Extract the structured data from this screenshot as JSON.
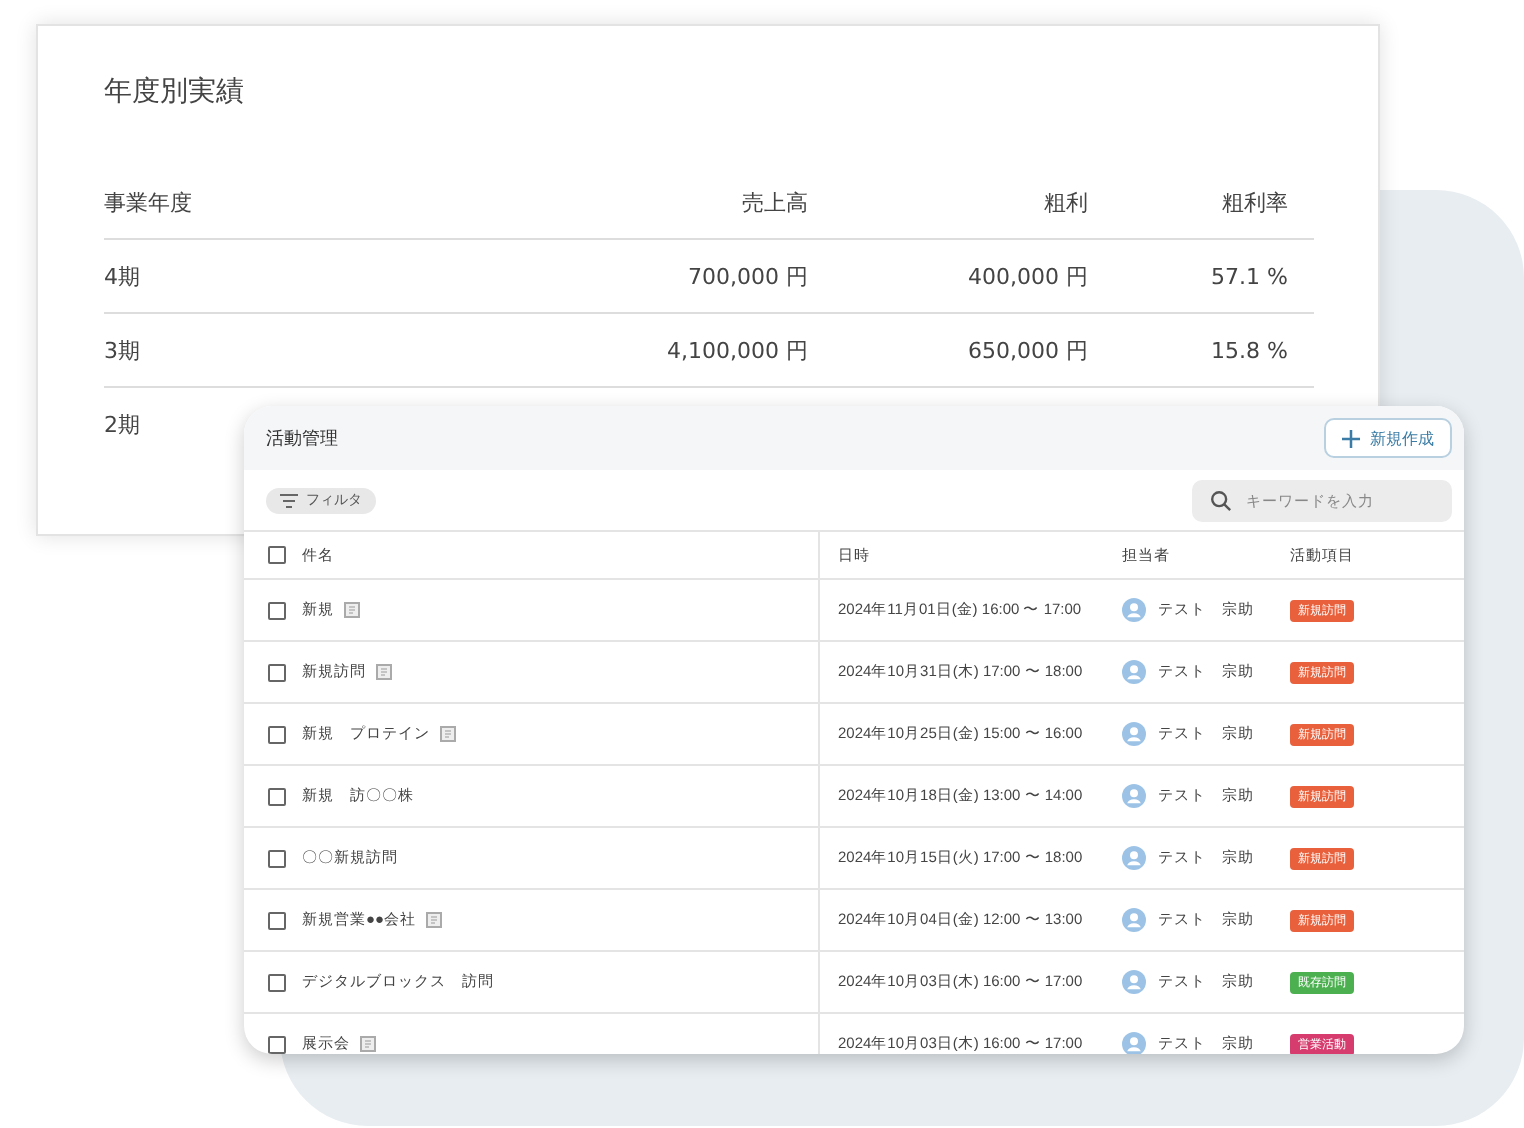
{
  "results_card": {
    "title": "年度別実績",
    "columns": [
      "事業年度",
      "売上高",
      "粗利",
      "粗利率"
    ],
    "rows": [
      [
        "4期",
        "700,000 円",
        "400,000 円",
        "57.1 %"
      ],
      [
        "3期",
        "4,100,000 円",
        "650,000 円",
        "15.8 %"
      ],
      [
        "2期"
      ]
    ]
  },
  "activity_card": {
    "title": "活動管理",
    "new_button": "新規作成",
    "filter": "フィルタ",
    "search": {
      "placeholder": "キーワードを入力"
    },
    "columns": [
      "件名",
      "日時",
      "担当者",
      "活動項目"
    ],
    "all_checked": false,
    "rows": [
      {
        "checked": false,
        "subject": "新規",
        "has_note": true,
        "datetime": "2024年11月01日(金) 16:00 〜 17:00",
        "owner": "テスト　宗助",
        "activity": "新規訪問",
        "color": "#e8603c"
      },
      {
        "checked": false,
        "subject": "新規訪問",
        "has_note": true,
        "datetime": "2024年10月31日(木) 17:00 〜 18:00",
        "owner": "テスト　宗助",
        "activity": "新規訪問",
        "color": "#e8603c"
      },
      {
        "checked": false,
        "subject": "新規　プロテイン",
        "has_note": true,
        "datetime": "2024年10月25日(金) 15:00 〜 16:00",
        "owner": "テスト　宗助",
        "activity": "新規訪問",
        "color": "#e8603c"
      },
      {
        "checked": false,
        "subject": "新規　訪〇〇株",
        "has_note": false,
        "datetime": "2024年10月18日(金) 13:00 〜 14:00",
        "owner": "テスト　宗助",
        "activity": "新規訪問",
        "color": "#e8603c"
      },
      {
        "checked": false,
        "subject": "〇〇新規訪問",
        "has_note": false,
        "datetime": "2024年10月15日(火) 17:00 〜 18:00",
        "owner": "テスト　宗助",
        "activity": "新規訪問",
        "color": "#e8603c"
      },
      {
        "checked": false,
        "subject": "新規営業●●会社",
        "has_note": true,
        "datetime": "2024年10月04日(金) 12:00 〜 13:00",
        "owner": "テスト　宗助",
        "activity": "新規訪問",
        "color": "#e8603c"
      },
      {
        "checked": false,
        "subject": "デジタルブロックス　訪問",
        "has_note": false,
        "datetime": "2024年10月03日(木) 16:00 〜 17:00",
        "owner": "テスト　宗助",
        "activity": "既存訪問",
        "color": "#4caf50"
      },
      {
        "checked": false,
        "subject": "展示会",
        "has_note": true,
        "datetime": "2024年10月03日(木) 16:00 〜 17:00",
        "owner": "テスト　宗助",
        "activity": "営業活動",
        "color": "#d63c6e"
      }
    ]
  }
}
